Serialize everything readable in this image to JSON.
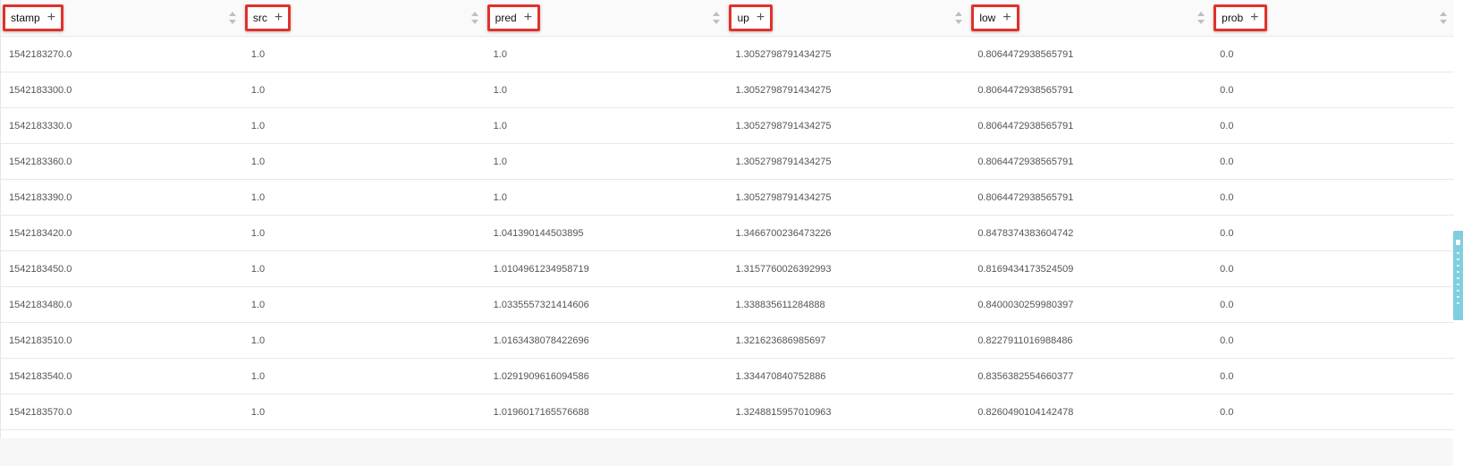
{
  "columns": [
    {
      "key": "stamp",
      "label": "stamp"
    },
    {
      "key": "src",
      "label": "src"
    },
    {
      "key": "pred",
      "label": "pred"
    },
    {
      "key": "up",
      "label": "up"
    },
    {
      "key": "low",
      "label": "low"
    },
    {
      "key": "prob",
      "label": "prob"
    }
  ],
  "add_glyph": "+",
  "rows": [
    [
      "1542183270.0",
      "1.0",
      "1.0",
      "1.3052798791434275",
      "0.8064472938565791",
      "0.0"
    ],
    [
      "1542183300.0",
      "1.0",
      "1.0",
      "1.3052798791434275",
      "0.8064472938565791",
      "0.0"
    ],
    [
      "1542183330.0",
      "1.0",
      "1.0",
      "1.3052798791434275",
      "0.8064472938565791",
      "0.0"
    ],
    [
      "1542183360.0",
      "1.0",
      "1.0",
      "1.3052798791434275",
      "0.8064472938565791",
      "0.0"
    ],
    [
      "1542183390.0",
      "1.0",
      "1.0",
      "1.3052798791434275",
      "0.8064472938565791",
      "0.0"
    ],
    [
      "1542183420.0",
      "1.0",
      "1.041390144503895",
      "1.3466700236473226",
      "0.8478374383604742",
      "0.0"
    ],
    [
      "1542183450.0",
      "1.0",
      "1.0104961234958719",
      "1.3157760026392993",
      "0.8169434173524509",
      "0.0"
    ],
    [
      "1542183480.0",
      "1.0",
      "1.0335557321414606",
      "1.338835611284888",
      "0.8400030259980397",
      "0.0"
    ],
    [
      "1542183510.0",
      "1.0",
      "1.0163438078422696",
      "1.321623686985697",
      "0.8227911016988486",
      "0.0"
    ],
    [
      "1542183540.0",
      "1.0",
      "1.0291909616094586",
      "1.334470840752886",
      "0.8356382554660377",
      "0.0"
    ],
    [
      "1542183570.0",
      "1.0",
      "1.0196017165576688",
      "1.3248815957010963",
      "0.8260490104142478",
      "0.0"
    ]
  ],
  "accent_colors": {
    "highlight_box": "#e0322b",
    "side_tab": "#7fcfe0"
  }
}
